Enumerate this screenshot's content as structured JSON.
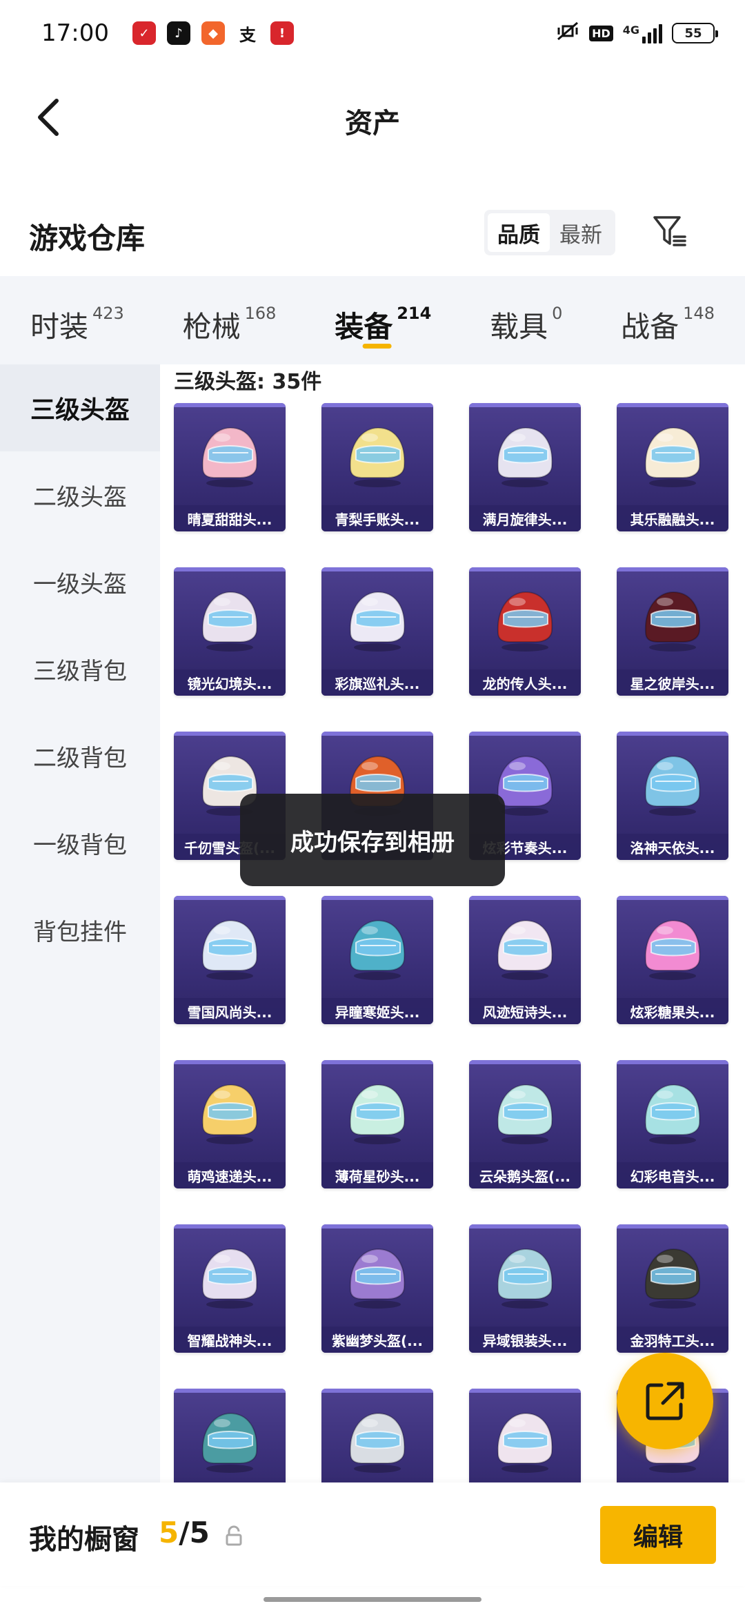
{
  "status_bar": {
    "time": "17:00",
    "battery": "55",
    "hd": "HD",
    "network": "4G"
  },
  "header": {
    "title": "资产"
  },
  "section": {
    "title": "游戏仓库",
    "sort_options": [
      "品质",
      "最新"
    ],
    "sort_selected": "品质"
  },
  "tabs": [
    {
      "label": "时装",
      "count": "423"
    },
    {
      "label": "枪械",
      "count": "168"
    },
    {
      "label": "装备",
      "count": "214",
      "active": true
    },
    {
      "label": "载具",
      "count": "0"
    },
    {
      "label": "战备",
      "count": "148"
    }
  ],
  "sidebar": {
    "items": [
      "三级头盔",
      "二级头盔",
      "一级头盔",
      "三级背包",
      "二级背包",
      "一级背包",
      "背包挂件"
    ],
    "active": "三级头盔"
  },
  "content": {
    "group_title": "三级头盔: 35件",
    "items": [
      {
        "name": "晴夏甜甜头...",
        "color": "#f3b7c8"
      },
      {
        "name": "青梨手账头...",
        "color": "#f2e08c"
      },
      {
        "name": "满月旋律头...",
        "color": "#e6e3f0"
      },
      {
        "name": "其乐融融头...",
        "color": "#f7ecd6"
      },
      {
        "name": "镜光幻境头...",
        "color": "#e9e1ee"
      },
      {
        "name": "彩旗巡礼头...",
        "color": "#ece9f5"
      },
      {
        "name": "龙的传人头...",
        "color": "#c9302c"
      },
      {
        "name": "星之彼岸头...",
        "color": "#5a1a24"
      },
      {
        "name": "千仞雪头盔(...",
        "color": "#ede6e2"
      },
      {
        "name": "",
        "color": "#e0602a"
      },
      {
        "name": "炫彩节奏头...",
        "color": "#8a6ad8"
      },
      {
        "name": "洛神天依头...",
        "color": "#7fc4e6"
      },
      {
        "name": "雪国风尚头...",
        "color": "#dfe8f6"
      },
      {
        "name": "异瞳寒姬头...",
        "color": "#4fb1c9"
      },
      {
        "name": "风迹短诗头...",
        "color": "#f1e6f2"
      },
      {
        "name": "炫彩糖果头...",
        "color": "#f28bd2"
      },
      {
        "name": "萌鸡速递头...",
        "color": "#f6cf6a"
      },
      {
        "name": "薄荷星砂头...",
        "color": "#c9efe1"
      },
      {
        "name": "云朵鹅头盔(...",
        "color": "#bfe8e6"
      },
      {
        "name": "幻彩电音头...",
        "color": "#a7e1e3"
      },
      {
        "name": "智耀战神头...",
        "color": "#e6def0"
      },
      {
        "name": "紫幽梦头盔(...",
        "color": "#9b7bd1"
      },
      {
        "name": "异域银装头...",
        "color": "#a9d3df"
      },
      {
        "name": "金羽特工头...",
        "color": "#3b3a33"
      },
      {
        "name": "",
        "color": "#4b9ca2"
      },
      {
        "name": "",
        "color": "#d9dde3"
      },
      {
        "name": "",
        "color": "#efe4ee"
      },
      {
        "name": "",
        "color": "#f4d6e2"
      }
    ]
  },
  "toast": "成功保存到相册",
  "bottom": {
    "label": "我的橱窗",
    "count_used": "5",
    "count_sep": "/",
    "count_total": "5",
    "edit_label": "编辑"
  },
  "colors": {
    "accent": "#f7b500",
    "card_bg": "#3a2f78"
  }
}
